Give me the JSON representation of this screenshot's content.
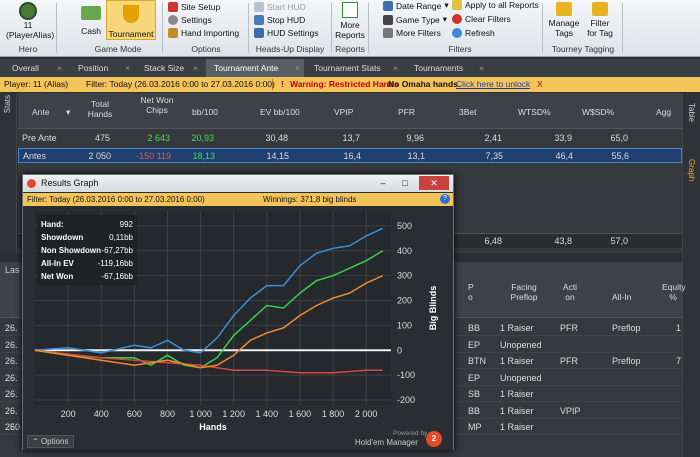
{
  "ribbon": {
    "hero": {
      "count": "11",
      "alias": "(PlayerAlias)",
      "label": "Hero"
    },
    "game_mode": {
      "cash": "Cash",
      "tournament": "Tournament",
      "label": "Game Mode"
    },
    "options": {
      "site_setup": "Site Setup",
      "settings": "Settings",
      "hand_importing": "Hand Importing",
      "label": "Options"
    },
    "hud": {
      "start": "Start HUD",
      "stop": "Stop HUD",
      "settings": "HUD Settings",
      "label": "Heads-Up Display"
    },
    "reports": {
      "more": "More",
      "reports": "Reports",
      "label": "Reports"
    },
    "filters": {
      "date_range": "Date Range",
      "game_type": "Game Type",
      "more_filters": "More Filters",
      "apply_all": "Apply to all Reports",
      "clear": "Clear Filters",
      "refresh": "Refresh",
      "label": "Filters"
    },
    "tagging": {
      "manage": "Manage",
      "tags": "Tags",
      "filter": "Filter",
      "for_tag": "for Tag",
      "label": "Tourney Tagging"
    }
  },
  "tabs": [
    "Overall",
    "Position",
    "Stack Size",
    "Tournament Ante",
    "Tournament Stats",
    "Tournaments"
  ],
  "filterbar": {
    "player": "Player: 11 (Alias)",
    "filter": "Filter: Today (26.03.2016 0:00 to 27.03.2016 0:00)",
    "warning": "Warning: Restricted Hands",
    "no_omaha": "No Omaha hands.",
    "unlock": "Click here to unlock",
    "close": "X"
  },
  "grid": {
    "headers": [
      "Ante",
      "Total Hands",
      "Net Won Chips",
      "bb/100",
      "EV bb/100",
      "VPIP",
      "PFR",
      "3Bet",
      "WTSD%",
      "W$SD%",
      "Agg"
    ],
    "rows": [
      {
        "name": "Pre Ante",
        "hands": "475",
        "net": "2 643",
        "bb": "20,93",
        "ev": "30,48",
        "vpip": "13,7",
        "pfr": "9,96",
        "tb": "2,41",
        "wtsd": "33,9",
        "wsd": "65,0"
      },
      {
        "name": "Antes",
        "hands": "2 050",
        "net": "-150 119",
        "bb": "18,13",
        "ev": "14,15",
        "vpip": "16,4",
        "pfr": "13,1",
        "tb": "7,35",
        "wtsd": "46,4",
        "wsd": "55,6"
      }
    ],
    "total": {
      "tb": "6,48",
      "wtsd": "43,8",
      "wsd": "57,0"
    }
  },
  "side": {
    "stats": "Stats",
    "table": "Table",
    "graph": "Graph"
  },
  "lower": {
    "last": "Las",
    "headers": {
      "pos": "P o",
      "facing": "Facing Preflop",
      "action": "Acti on",
      "allin": "All-In",
      "equity": "Equity %"
    },
    "rows": [
      {
        "left": "26.",
        "pos": "BB",
        "facing": "1 Raiser",
        "action": "PFR",
        "allin": "Preflop",
        "eq": "1"
      },
      {
        "left": "26.",
        "pos": "EP",
        "facing": "Unopened",
        "action": "",
        "allin": "",
        "eq": ""
      },
      {
        "left": "26.",
        "pos": "BTN",
        "facing": "1 Raiser",
        "action": "PFR",
        "allin": "Preflop",
        "eq": "7"
      },
      {
        "left": "26.",
        "pos": "EP",
        "facing": "Unopened",
        "action": "",
        "allin": "",
        "eq": ""
      },
      {
        "left": "26.",
        "pos": "SB",
        "facing": "1 Raiser",
        "action": "",
        "allin": "",
        "eq": ""
      },
      {
        "left": "26.",
        "pos": "BB",
        "facing": "1 Raiser",
        "action": "VPIP",
        "allin": "",
        "eq": ""
      },
      {
        "left": "26.",
        "pos": "MP",
        "facing": "1 Raiser",
        "action": "",
        "allin": "",
        "eq": ""
      }
    ],
    "bottom_left": "250"
  },
  "graph_window": {
    "title": "Results Graph",
    "filter": "Filter: Today (26.03.2016 0:00 to 27.03.2016 0:00)",
    "winnings": "Winnings: 371,8 big blinds",
    "info_icon": "?",
    "options": "Options",
    "powered": "Powered by",
    "brand": "Hold'em Manager",
    "stats": [
      {
        "label": "Hand:",
        "value": "992"
      },
      {
        "label": "Showdown",
        "value": "0,11bb"
      },
      {
        "label": "Non Showdown",
        "value": "-67,27bb"
      },
      {
        "label": "All-In EV",
        "value": "-119,16bb"
      },
      {
        "label": "Net Won",
        "value": "-67,16bb"
      }
    ]
  },
  "chart_data": {
    "type": "line",
    "xlabel": "Hands",
    "ylabel": "Big Blinds",
    "xlim": [
      0,
      2150
    ],
    "ylim": [
      -220,
      560
    ],
    "x_ticks": [
      "200",
      "400",
      "600",
      "800",
      "1 000",
      "1 200",
      "1 400",
      "1 600",
      "1 800",
      "2 000"
    ],
    "y_ticks": [
      "-200",
      "-100",
      "0",
      "100",
      "200",
      "300",
      "400",
      "500"
    ],
    "colors": {
      "Net Won": "#35d04a",
      "Non Showdown": "#d04848",
      "Showdown": "#3a8fd8",
      "All-In EV": "#f08a2a"
    },
    "series": [
      {
        "name": "Net Won",
        "x": [
          0,
          200,
          400,
          600,
          700,
          800,
          900,
          1000,
          1100,
          1200,
          1300,
          1400,
          1500,
          1600,
          1700,
          1800,
          1900,
          2000,
          2100
        ],
        "y": [
          0,
          -20,
          -30,
          -30,
          -60,
          -20,
          -60,
          -70,
          -30,
          60,
          120,
          180,
          170,
          230,
          280,
          300,
          330,
          360,
          400
        ]
      },
      {
        "name": "Non Showdown",
        "x": [
          0,
          200,
          400,
          600,
          800,
          1000,
          1200,
          1400,
          1600,
          1800,
          2000,
          2100
        ],
        "y": [
          0,
          -15,
          -30,
          -40,
          -50,
          -60,
          -80,
          -80,
          -90,
          -90,
          -80,
          -80
        ]
      },
      {
        "name": "Showdown",
        "x": [
          0,
          200,
          400,
          600,
          700,
          800,
          900,
          1000,
          1100,
          1200,
          1300,
          1400,
          1500,
          1600,
          1700,
          1800,
          1900,
          2000,
          2100
        ],
        "y": [
          0,
          10,
          -10,
          20,
          10,
          40,
          0,
          -10,
          50,
          140,
          210,
          260,
          260,
          340,
          390,
          410,
          420,
          460,
          490
        ]
      },
      {
        "name": "All-In EV",
        "x": [
          0,
          200,
          400,
          600,
          800,
          1000,
          1100,
          1200,
          1300,
          1400,
          1500,
          1600,
          1700,
          1800,
          1900,
          2000,
          2100
        ],
        "y": [
          0,
          -20,
          -40,
          -60,
          -40,
          -70,
          -60,
          -20,
          40,
          70,
          90,
          140,
          180,
          210,
          230,
          270,
          300
        ]
      }
    ]
  }
}
